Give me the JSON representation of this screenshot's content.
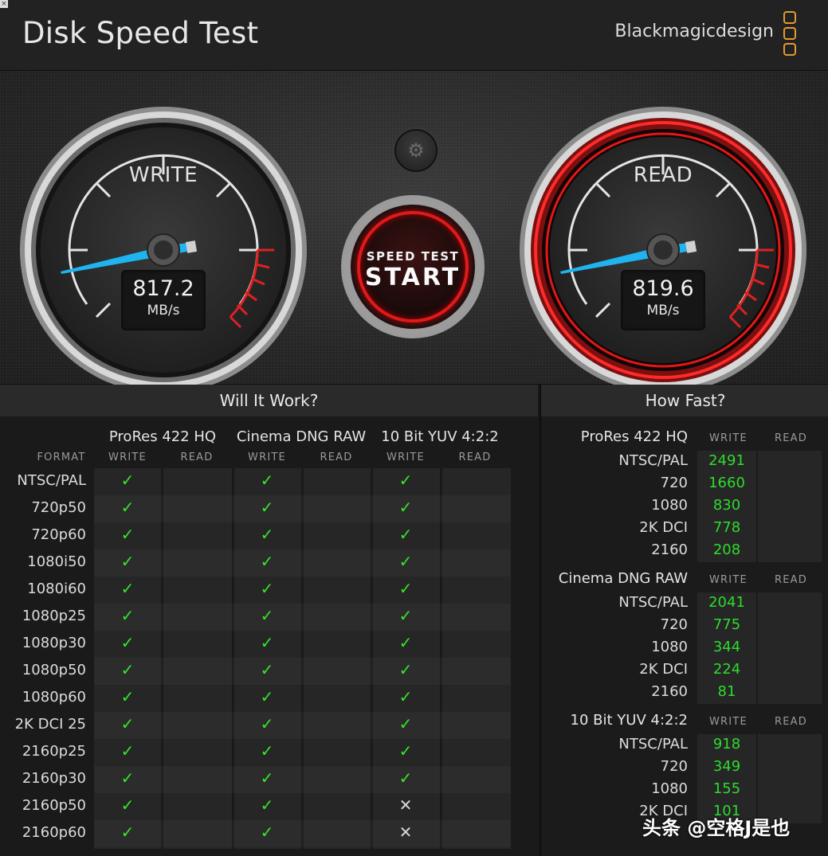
{
  "app": {
    "title": "Disk Speed Test",
    "brand": "Blackmagicdesign",
    "close_glyph": "×"
  },
  "gauges": {
    "write": {
      "label": "WRITE",
      "value": "817.2",
      "unit": "MB/s"
    },
    "read": {
      "label": "READ",
      "value": "819.6",
      "unit": "MB/s"
    }
  },
  "controls": {
    "settings_icon": "gear-icon",
    "start_small": "SPEED TEST",
    "start_big": "START"
  },
  "will_it_work": {
    "title": "Will It Work?",
    "format_header": "FORMAT",
    "write_header": "WRITE",
    "read_header": "READ",
    "codecs": [
      "ProRes 422 HQ",
      "Cinema DNG RAW",
      "10 Bit YUV 4:2:2"
    ],
    "formats": [
      "NTSC/PAL",
      "720p50",
      "720p60",
      "1080i50",
      "1080i60",
      "1080p25",
      "1080p30",
      "1080p50",
      "1080p60",
      "2K DCI 25",
      "2160p25",
      "2160p30",
      "2160p50",
      "2160p60"
    ],
    "marks": {
      "ok": "✓",
      "no": "✕"
    },
    "write_results": [
      [
        "ok",
        "ok",
        "ok"
      ],
      [
        "ok",
        "ok",
        "ok"
      ],
      [
        "ok",
        "ok",
        "ok"
      ],
      [
        "ok",
        "ok",
        "ok"
      ],
      [
        "ok",
        "ok",
        "ok"
      ],
      [
        "ok",
        "ok",
        "ok"
      ],
      [
        "ok",
        "ok",
        "ok"
      ],
      [
        "ok",
        "ok",
        "ok"
      ],
      [
        "ok",
        "ok",
        "ok"
      ],
      [
        "ok",
        "ok",
        "ok"
      ],
      [
        "ok",
        "ok",
        "ok"
      ],
      [
        "ok",
        "ok",
        "ok"
      ],
      [
        "ok",
        "ok",
        "no"
      ],
      [
        "ok",
        "ok",
        "no"
      ]
    ]
  },
  "how_fast": {
    "title": "How Fast?",
    "write_header": "WRITE",
    "read_header": "READ",
    "sections": [
      {
        "codec": "ProRes 422 HQ",
        "rows": [
          {
            "label": "NTSC/PAL",
            "write": "2491"
          },
          {
            "label": "720",
            "write": "1660"
          },
          {
            "label": "1080",
            "write": "830"
          },
          {
            "label": "2K DCI",
            "write": "778"
          },
          {
            "label": "2160",
            "write": "208"
          }
        ]
      },
      {
        "codec": "Cinema DNG RAW",
        "rows": [
          {
            "label": "NTSC/PAL",
            "write": "2041"
          },
          {
            "label": "720",
            "write": "775"
          },
          {
            "label": "1080",
            "write": "344"
          },
          {
            "label": "2K DCI",
            "write": "224"
          },
          {
            "label": "2160",
            "write": "81"
          }
        ]
      },
      {
        "codec": "10 Bit YUV 4:2:2",
        "rows": [
          {
            "label": "NTSC/PAL",
            "write": "918"
          },
          {
            "label": "720",
            "write": "349"
          },
          {
            "label": "1080",
            "write": "155"
          },
          {
            "label": "2K DCI",
            "write": "101"
          }
        ]
      }
    ]
  },
  "watermark": "头条 @空格J是也",
  "colors": {
    "brand_accent": "#e39a2f",
    "needle": "#1fb4f0",
    "redline": "#e02020",
    "ok_green": "#37e52a"
  }
}
